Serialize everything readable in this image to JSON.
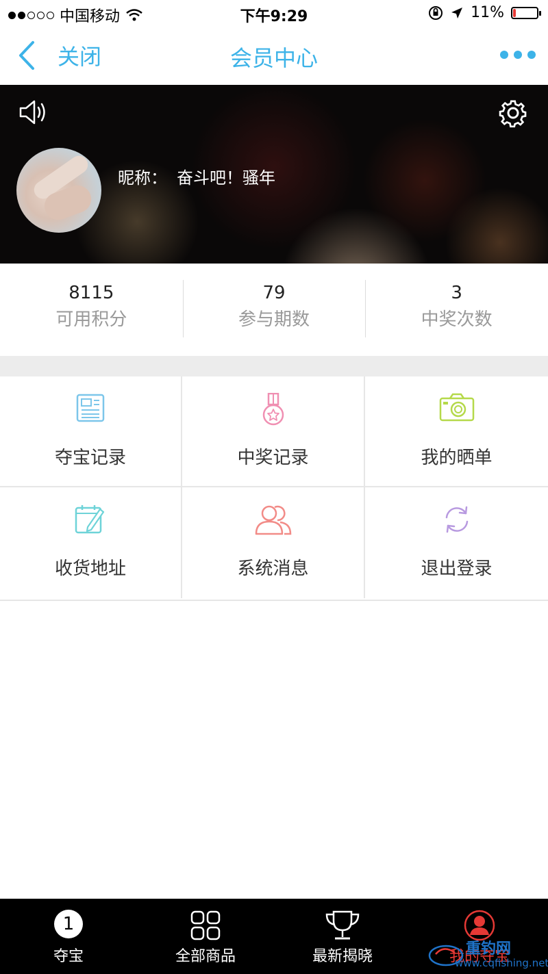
{
  "status_bar": {
    "carrier": "中国移动",
    "time": "下午9:29",
    "battery": "11%",
    "battery_level": 0.11
  },
  "nav": {
    "back_label": "关闭",
    "title": "会员中心"
  },
  "profile": {
    "nickname_label": "昵称：",
    "nickname": "奋斗吧！骚年"
  },
  "stats": [
    {
      "value": "8115",
      "label": "可用积分"
    },
    {
      "value": "79",
      "label": "参与期数"
    },
    {
      "value": "3",
      "label": "中奖次数"
    }
  ],
  "menu": [
    {
      "label": "夺宝记录",
      "icon": "newspaper-icon",
      "color": "#7cc6ea"
    },
    {
      "label": "中奖记录",
      "icon": "medal-icon",
      "color": "#f08fb2"
    },
    {
      "label": "我的晒单",
      "icon": "camera-icon",
      "color": "#b5d94a"
    },
    {
      "label": "收货地址",
      "icon": "calendar-edit-icon",
      "color": "#6ed3d8"
    },
    {
      "label": "系统消息",
      "icon": "users-icon",
      "color": "#f28b87"
    },
    {
      "label": "退出登录",
      "icon": "refresh-icon",
      "color": "#b89ae0"
    }
  ],
  "tabs": [
    {
      "label": "夺宝",
      "icon": "number-one-icon",
      "badge": "1"
    },
    {
      "label": "全部商品",
      "icon": "grid-icon"
    },
    {
      "label": "最新揭晓",
      "icon": "trophy-icon"
    },
    {
      "label": "我的夺宝",
      "icon": "user-icon",
      "active": true
    }
  ],
  "watermark": {
    "name": "重钓网",
    "url": "www.cqfishing.net"
  },
  "colors": {
    "accent": "#3db3e8",
    "active_tab": "#e53935"
  }
}
